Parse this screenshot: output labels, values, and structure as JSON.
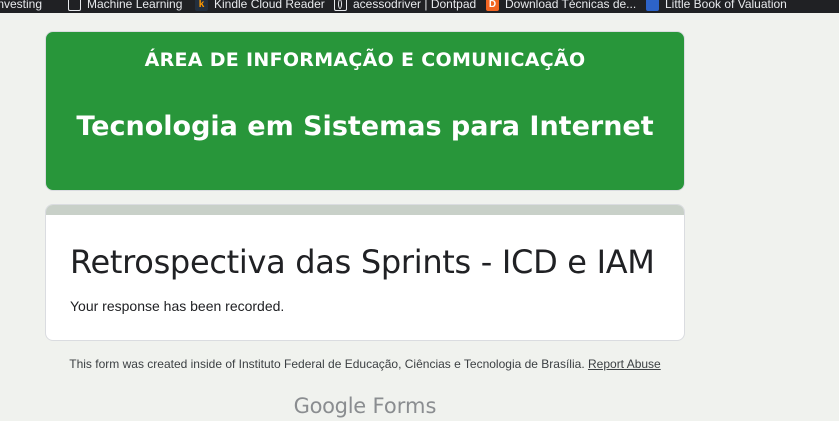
{
  "bookmarks": [
    {
      "label": "Investing",
      "icon": "none"
    },
    {
      "label": "Machine Learning",
      "icon": "folder-icon"
    },
    {
      "label": "Kindle Cloud Reader",
      "icon": "kindle-icon"
    },
    {
      "label": "acessodriver | Dontpad",
      "icon": "globe-icon"
    },
    {
      "label": "Download Técnicas de...",
      "icon": "d-icon"
    },
    {
      "label": "Little Book of Valuation",
      "icon": "shield-icon"
    }
  ],
  "banner": {
    "subtitle": "ÁREA DE INFORMAÇÃO E COMUNICAÇÃO",
    "title": "Tecnologia em Sistemas para Internet",
    "color": "#28963a"
  },
  "form": {
    "title": "Retrospectiva das Sprints - ICD e IAM",
    "message": "Your response has been recorded."
  },
  "footer": {
    "text": "This form was created inside of Instituto Federal de Educação, Ciências e Tecnologia de Brasília.",
    "report_link": "Report Abuse",
    "brand_google": "Google",
    "brand_forms": "Forms"
  }
}
